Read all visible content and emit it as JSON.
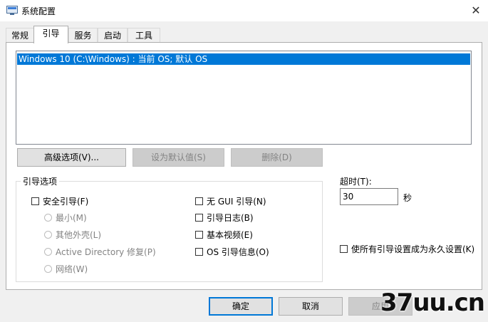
{
  "window": {
    "title": "系统配置",
    "icon": "msconfig-icon",
    "close_glyph": "✕"
  },
  "tabs": [
    {
      "label": "常规",
      "active": false
    },
    {
      "label": "引导",
      "active": true
    },
    {
      "label": "服务",
      "active": false
    },
    {
      "label": "启动",
      "active": false
    },
    {
      "label": "工具",
      "active": false
    }
  ],
  "boot": {
    "os_list": [
      "Windows 10 (C:\\Windows) : 当前 OS; 默认 OS"
    ],
    "buttons": {
      "advanced": "高级选项(V)...",
      "set_default": "设为默认值(S)",
      "delete": "删除(D)"
    },
    "options": {
      "group_label": "引导选项",
      "safe_boot": "安全引导(F)",
      "minimal": "最小(M)",
      "alternate_shell": "其他外壳(L)",
      "active_directory": "Active Directory 修复(P)",
      "network": "网络(W)",
      "no_gui": "无 GUI 引导(N)",
      "boot_log": "引导日志(B)",
      "base_video": "基本视频(E)",
      "os_boot_info": "OS 引导信息(O)"
    },
    "timeout": {
      "label": "超时(T):",
      "value": "30",
      "unit": "秒"
    },
    "make_permanent": "使所有引导设置成为永久设置(K)"
  },
  "footer": {
    "ok": "确定",
    "cancel": "取消",
    "apply": "应用"
  },
  "watermark": "37uu.cn",
  "colors": {
    "selection": "#0078d7",
    "window_bg": "#f0f0f0",
    "panel_bg": "#ffffff",
    "disabled_text": "#838383"
  }
}
